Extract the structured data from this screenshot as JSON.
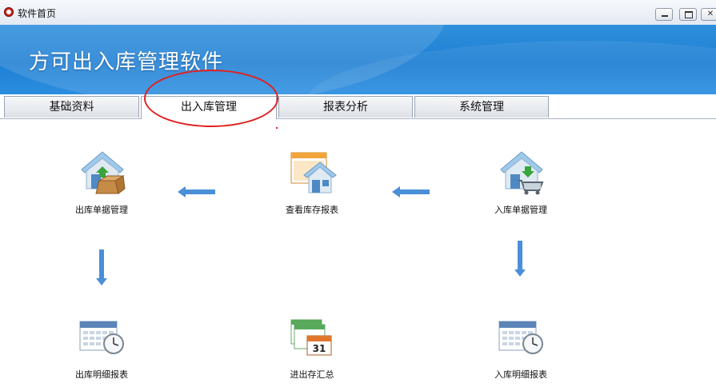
{
  "window": {
    "title": "软件首页"
  },
  "banner": {
    "title": "方可出入库管理软件"
  },
  "tabs": [
    {
      "label": "基础资料",
      "active": false
    },
    {
      "label": "出入库管理",
      "active": true
    },
    {
      "label": "报表分析",
      "active": false
    },
    {
      "label": "系统管理",
      "active": false
    }
  ],
  "modules": {
    "outbound_docs": {
      "label": "出库单据管理",
      "icon": "house-box-icon"
    },
    "stock_report": {
      "label": "查看库存报表",
      "icon": "house-window-icon"
    },
    "inbound_docs": {
      "label": "入库单据管理",
      "icon": "house-cart-icon"
    },
    "outbound_detail": {
      "label": "出库明细报表",
      "icon": "calendar-clock-icon"
    },
    "inout_summary": {
      "label": "进出存汇总",
      "icon": "calendar-31-icon",
      "calendar_day": "31"
    },
    "inbound_detail": {
      "label": "入库明细报表",
      "icon": "calendar-clock-icon"
    }
  },
  "colors": {
    "banner": "#1f7fd3",
    "highlight": "#e02020",
    "arrow": "#4a8fd8"
  }
}
